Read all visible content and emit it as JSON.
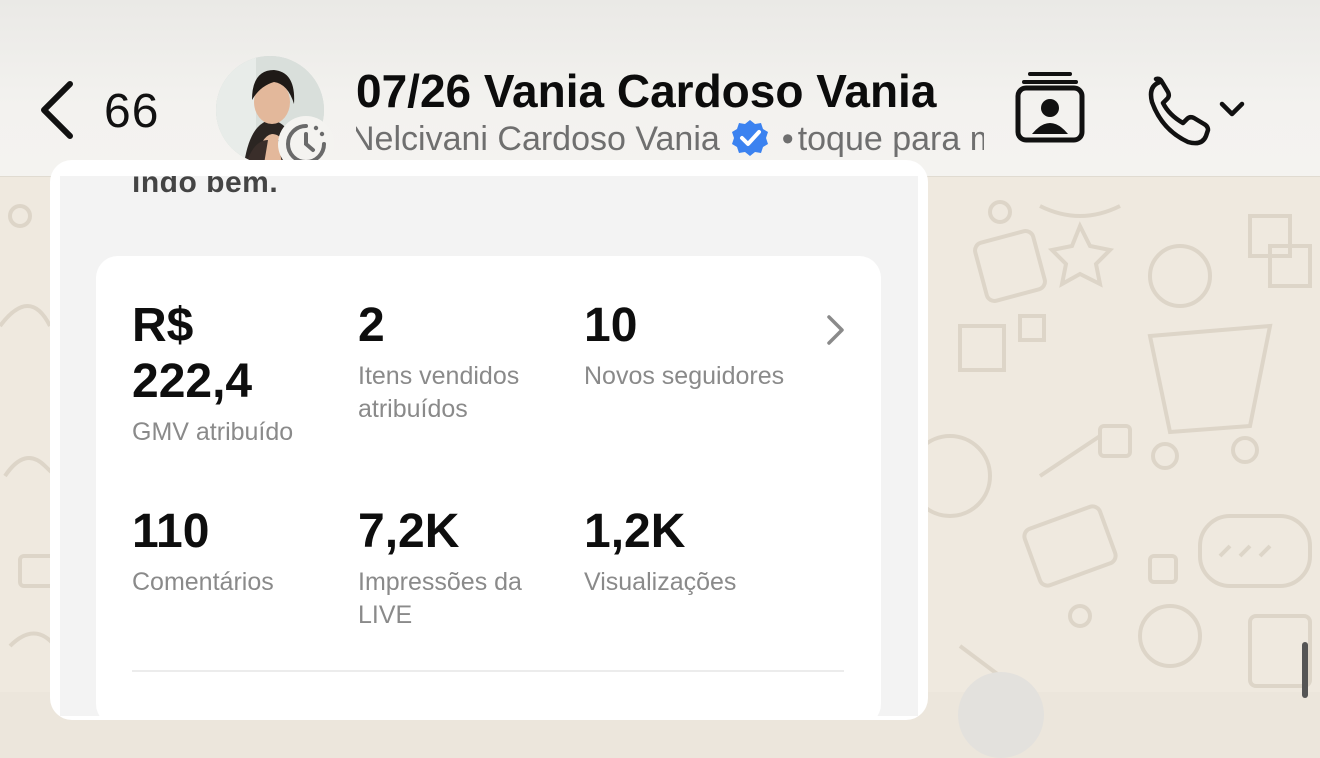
{
  "header": {
    "back_count": "66",
    "title": "07/26 Vania Cardoso Vania",
    "subtitle_name": "Nelcivani Cardoso Vania",
    "subtitle_separator": "•",
    "subtitle_hint": "toque para mais informações",
    "icons": [
      "chevron-left-icon",
      "timer-icon",
      "verified-icon",
      "contact-card-icon",
      "phone-icon",
      "chevron-down-icon"
    ]
  },
  "message": {
    "cut_text": "indo bem.",
    "metrics": [
      {
        "value": "R$ 222,4",
        "value_line1": "R$",
        "value_line2": "222,4",
        "label": "GMV atribuído"
      },
      {
        "value": "2",
        "label_line1": "Itens vendidos",
        "label_line2": "atribuídos"
      },
      {
        "value": "10",
        "label": "Novos seguidores"
      },
      {
        "value": "110",
        "label": "Comentários"
      },
      {
        "value": "7,2K",
        "label_line1": "Impressões da",
        "label_line2": "LIVE"
      },
      {
        "value": "1,2K",
        "label": "Visualizações"
      }
    ]
  },
  "colors": {
    "header_bg": "#f3f2ef",
    "wallpaper": "#efe9df",
    "verified_blue": "#3b82f0",
    "value_text": "#0e0e0e",
    "label_text": "#8a8a8a"
  }
}
